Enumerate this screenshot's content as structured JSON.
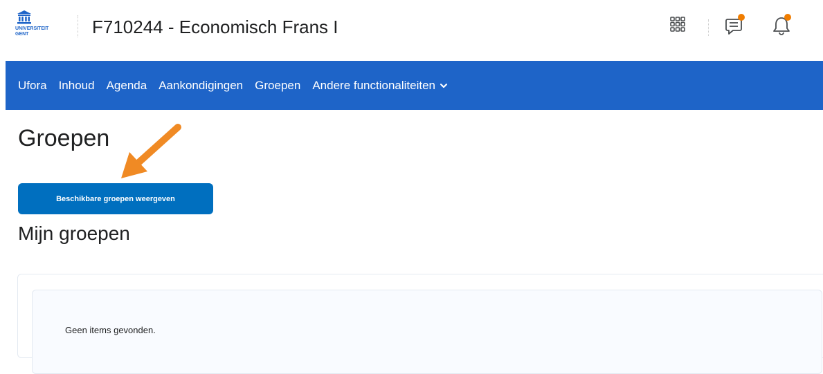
{
  "header": {
    "logo": {
      "line1": "UNIVERSITEIT",
      "line2": "GENT"
    },
    "course_title": "F710244 - Economisch Frans I",
    "icons": [
      "apps-grid-icon",
      "chat-icon",
      "bell-icon"
    ],
    "notification_dot_color": "#f07d00"
  },
  "nav": {
    "background": "#1e64c8",
    "items": [
      {
        "label": "Ufora"
      },
      {
        "label": "Inhoud"
      },
      {
        "label": "Agenda"
      },
      {
        "label": "Aankondigingen"
      },
      {
        "label": "Groepen"
      },
      {
        "label": "Andere functionaliteiten",
        "icon": "chevron-down-icon"
      }
    ]
  },
  "main": {
    "page_title": "Groepen",
    "primary_button": "Beschikbare groepen weergeven",
    "section_title": "Mijn groepen",
    "empty_state": "Geen items gevonden."
  },
  "annotation": {
    "type": "arrow",
    "color": "#f08a24",
    "points_to": "primary_button"
  }
}
